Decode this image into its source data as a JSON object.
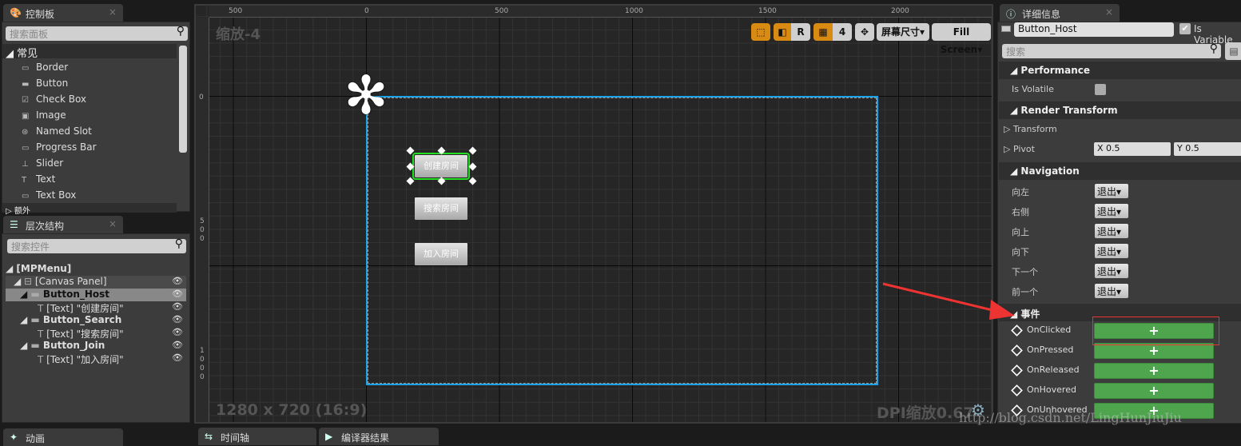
{
  "palette": {
    "tab": "控制板",
    "close": "×",
    "search_placeholder": "搜索面板",
    "category_common": "常见",
    "category_next": "额外",
    "items": [
      {
        "label": "Border",
        "icon": "▭"
      },
      {
        "label": "Button",
        "icon": "▬"
      },
      {
        "label": "Check Box",
        "icon": "☑"
      },
      {
        "label": "Image",
        "icon": "▣"
      },
      {
        "label": "Named Slot",
        "icon": "⊛"
      },
      {
        "label": "Progress Bar",
        "icon": "▭"
      },
      {
        "label": "Slider",
        "icon": "⊥"
      },
      {
        "label": "Text",
        "icon": "T"
      },
      {
        "label": "Text Box",
        "icon": "▭"
      }
    ]
  },
  "hierarchy": {
    "tab": "层次结构",
    "search_placeholder": "搜索控件",
    "rows": [
      {
        "label": "[MPMenu]"
      },
      {
        "label": "[Canvas Panel]"
      },
      {
        "label": "Button_Host"
      },
      {
        "label": "[Text] \"创建房间\""
      },
      {
        "label": "Button_Search"
      },
      {
        "label": "[Text] \"搜索房间\""
      },
      {
        "label": "Button_Join"
      },
      {
        "label": "[Text] \"加入房间\""
      }
    ]
  },
  "bottom_tabs": [
    "动画",
    "时间轴",
    "编译器结果"
  ],
  "viewport": {
    "zoom_label": "缩放-4",
    "resolution": "1280 x 720 (16:9)",
    "dpi": "DPI缩放0.67",
    "ruler_top": [
      "500",
      "0",
      "500",
      "1000",
      "1500",
      "2000"
    ],
    "ruler_left": [
      "0",
      "500",
      "1000"
    ],
    "toolbar": {
      "r": "R",
      "grid_snap": "4",
      "screen_size": "屏幕尺寸",
      "fill_screen": "Fill Screen"
    },
    "buttons": [
      "创建房间",
      "搜索房间",
      "加入房间"
    ],
    "selection_color": "#22dd22",
    "canvas_border_color": "#1aa3e8"
  },
  "details": {
    "tab": "详细信息",
    "name_value": "Button_Host",
    "is_variable": "Is Variable",
    "is_variable_checked": true,
    "search_placeholder": "搜索",
    "performance": {
      "header": "Performance",
      "is_volatile": "Is Volatile",
      "is_volatile_checked": false
    },
    "render_transform": {
      "header": "Render Transform",
      "transform": "Transform",
      "pivot": "Pivot",
      "pivot_x": "X  0.5",
      "pivot_y": "Y  0.5"
    },
    "navigation": {
      "header": "Navigation",
      "rows": [
        {
          "label": "向左",
          "value": "退出"
        },
        {
          "label": "右侧",
          "value": "退出"
        },
        {
          "label": "向上",
          "value": "退出"
        },
        {
          "label": "向下",
          "value": "退出"
        },
        {
          "label": "下一个",
          "value": "退出"
        },
        {
          "label": "前一个",
          "value": "退出"
        }
      ]
    },
    "events": {
      "header": "事件",
      "rows": [
        {
          "label": "OnClicked",
          "button": "+"
        },
        {
          "label": "OnPressed",
          "button": "+"
        },
        {
          "label": "OnReleased",
          "button": "+"
        },
        {
          "label": "OnHovered",
          "button": "+"
        },
        {
          "label": "OnUnhovered",
          "button": "+"
        }
      ]
    }
  },
  "watermark": "http://blog.csdn.net/LingHunJiuJiu",
  "annotation_color": "#ee3333"
}
